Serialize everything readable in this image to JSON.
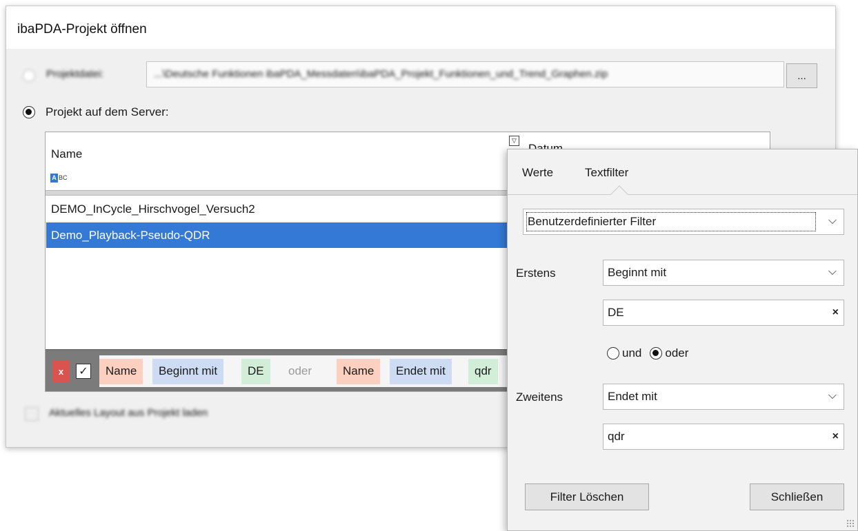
{
  "dialog": {
    "title": "ibaPDA-Projekt öffnen",
    "project_file_label": "Projektdatei:",
    "project_file_path": "...\\Deutsche Funktionen ibaPDA_Messdaten\\ibaPDA_Projekt_Funktionen_und_Trend_Graphen.zip",
    "browse_label": "...",
    "server_option_label": "Projekt auf dem Server:",
    "load_layout_label": "Aktuelles Layout aus Projekt laden"
  },
  "grid": {
    "columns": {
      "name": "Name",
      "date": "Datum"
    },
    "name_filter_icon": "abc-text-filter-icon",
    "rows": [
      {
        "name": "DEMO_InCycle_Hirschvogel_Versuch2",
        "selected": false
      },
      {
        "name": "Demo_Playback-Pseudo-QDR",
        "selected": true
      }
    ],
    "selection_color": "#3479d6"
  },
  "filterbar": {
    "clear_label": "x",
    "check_mark": "✓",
    "chips": [
      {
        "text": "Name",
        "kind": "field"
      },
      {
        "text": "Beginnt mit",
        "kind": "op"
      },
      {
        "text": "DE",
        "kind": "val"
      },
      {
        "text": "oder",
        "kind": "logic"
      },
      {
        "text": "Name",
        "kind": "field"
      },
      {
        "text": "Endet mit",
        "kind": "op"
      },
      {
        "text": "qdr",
        "kind": "val"
      }
    ]
  },
  "popup": {
    "tabs": [
      "Werte",
      "Textfilter"
    ],
    "active_tab": "Textfilter",
    "filter_type": "Benutzerdefinierter Filter",
    "first_label": "Erstens",
    "first_operator": "Beginnt mit",
    "first_value": "DE",
    "logic_and": "und",
    "logic_or": "oder",
    "logic_selected": "oder",
    "second_label": "Zweitens",
    "second_operator": "Endet mit",
    "second_value": "qdr",
    "clear_button": "Filter Löschen",
    "close_button": "Schließen",
    "clear_glyph": "×",
    "chevron_glyph": "⌵"
  }
}
